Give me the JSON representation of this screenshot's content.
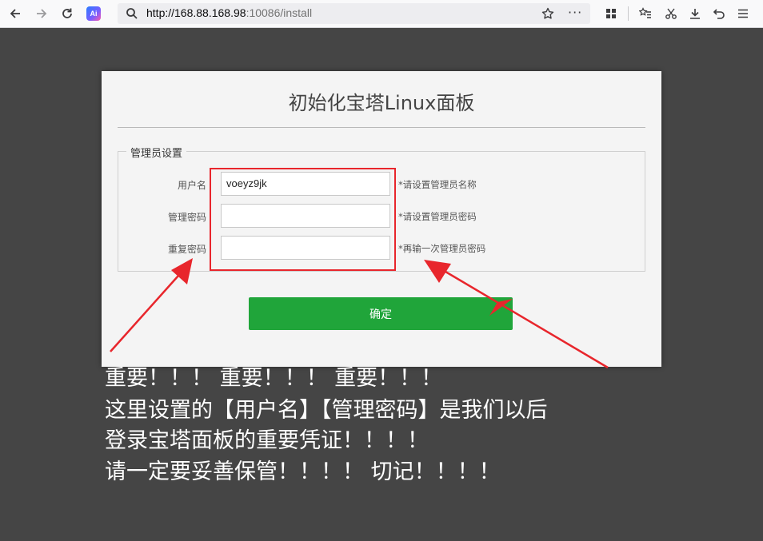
{
  "browser": {
    "url_host": "http://168.88.168.98",
    "url_path": ":10086/install",
    "ai_badge": "Ai",
    "more_label": "···"
  },
  "dialog": {
    "title": "初始化宝塔Linux面板",
    "section": "管理员设置",
    "fields": [
      {
        "label": "用户名",
        "value": "voeyz9jk",
        "hint": "*请设置管理员名称"
      },
      {
        "label": "管理密码",
        "value": "",
        "hint": "*请设置管理员密码"
      },
      {
        "label": "重复密码",
        "value": "",
        "hint": "*再输一次管理员密码"
      }
    ],
    "submit_label": "确定"
  },
  "notes": [
    "重要！！！ 重要！！！ 重要！！！",
    "这里设置的【用户名】【管理密码】是我们以后",
    "登录宝塔面板的重要凭证！！！！",
    "请一定要妥善保管！！！！ 切记！！！！"
  ],
  "colors": {
    "background": "#454545",
    "accent_green": "#20a53a",
    "annotation_red": "#e8262c"
  }
}
